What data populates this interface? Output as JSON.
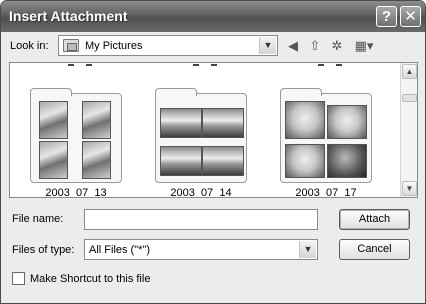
{
  "window": {
    "title": "Insert Attachment",
    "help_glyph": "?",
    "close_glyph": "✕"
  },
  "toolbar": {
    "look_in_label": "Look in:",
    "look_in_value": "My Pictures",
    "look_in_icon": "my-pictures-folder-icon",
    "back_glyph": "◀",
    "up_glyph": "⇧",
    "new_folder_glyph": "✲",
    "views_glyph": "▦▾"
  },
  "files": [
    {
      "name": "2003_07_13",
      "photo_style": "four-child-portraits"
    },
    {
      "name": "2003_07_14",
      "photo_style": "four-baby-photos"
    },
    {
      "name": "2003_07_17",
      "photo_style": "four-child-faces"
    }
  ],
  "form": {
    "file_name_label": "File name:",
    "file_name_value": "",
    "files_of_type_label": "Files of type:",
    "files_of_type_value": "All Files (\"*\")",
    "make_shortcut_label": "Make Shortcut to this file",
    "make_shortcut_checked": false
  },
  "buttons": {
    "attach": "Attach",
    "cancel": "Cancel"
  },
  "scrollbar": {
    "up_glyph": "▲",
    "down_glyph": "▼"
  }
}
